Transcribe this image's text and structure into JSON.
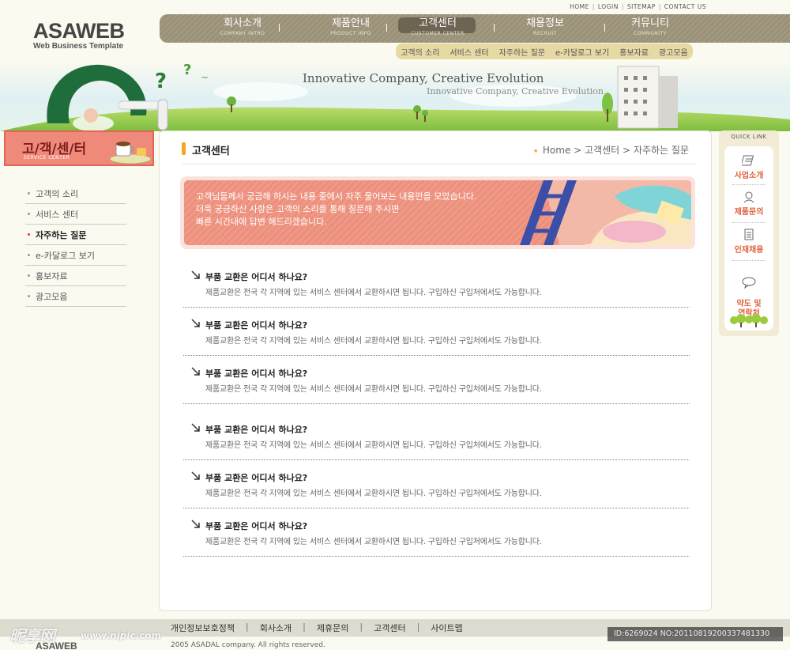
{
  "util": [
    "HOME",
    "LOGIN",
    "SITEMAP",
    "CONTACT US"
  ],
  "logo": {
    "title": "ASAWEB",
    "subtitle": "Web Business Template"
  },
  "gnb": [
    {
      "ko": "회사소개",
      "en": "COMPANY INTRO"
    },
    {
      "ko": "제품안내",
      "en": "PRODUCT INFO"
    },
    {
      "ko": "고객센터",
      "en": "CUSTOMER CENTER",
      "active": true
    },
    {
      "ko": "채용정보",
      "en": "RECRUIT"
    },
    {
      "ko": "커뮤니티",
      "en": "COMMUNITY"
    }
  ],
  "subnav": [
    "고객의 소리",
    "서비스 센터",
    "자주하는 질문",
    "e-카달로그 보기",
    "홍보자료",
    "광고모음"
  ],
  "banner": {
    "title": "Innovative Company, Creative Evolution",
    "subtitle": "Innovative Company, Creative Evolution"
  },
  "left": {
    "title": "고/객/센/터",
    "title_en": "SERVICE CENTER",
    "menu": [
      "고객의 소리",
      "서비스 센터",
      "자주하는 질문",
      "e-카달로그 보기",
      "홍보자료",
      "광고모음"
    ],
    "active_index": 2
  },
  "page": {
    "title": "고객센터",
    "breadcrumb": {
      "home": "Home",
      "sep": ">",
      "section": "고객센터",
      "current": "자주하는 질문"
    },
    "intro": [
      "고객님들께서 궁금해 하시는 내용 중에서 자주 물어보는 내용만을 모았습니다.",
      "더욱 궁금하신 사항은 고객의 소리를 통해 질문해 주시면",
      "빠른 시간내에 답변 해드리겠습니다."
    ],
    "faqs": [
      {
        "q": "부품 교환은 어디서 하나요?",
        "a": "제품교환은 전국 각 지역에 있는 서비스 센터에서 교환하시면 됩니다. 구입하신 구입처에서도 가능합니다."
      },
      {
        "q": "부품 교환은 어디서 하나요?",
        "a": "제품교환은 전국 각 지역에 있는 서비스 센터에서 교환하시면 됩니다. 구입하신 구입처에서도 가능합니다."
      },
      {
        "q": "부품 교환은 어디서 하나요?",
        "a": "제품교환은 전국 각 지역에 있는 서비스 센터에서 교환하시면 됩니다. 구입하신 구입처에서도 가능합니다."
      },
      {
        "q": "부품 교환은 어디서 하나요?",
        "a": "제품교환은 전국 각 지역에 있는 서비스 센터에서 교환하시면 됩니다. 구입하신 구입처에서도 가능합니다."
      },
      {
        "q": "부품 교환은 어디서 하나요?",
        "a": "제품교환은 전국 각 지역에 있는 서비스 센터에서 교환하시면 됩니다. 구입하신 구입처에서도 가능합니다."
      },
      {
        "q": "부품 교환은 어디서 하나요?",
        "a": "제품교환은 전국 각 지역에 있는 서비스 센터에서 교환하시면 됩니다. 구입하신 구입처에서도 가능합니다."
      }
    ]
  },
  "quick": {
    "title": "QUICK LINK",
    "items": [
      {
        "label": "사업소개",
        "icon": "document-icon"
      },
      {
        "label": "제품문의",
        "icon": "person-icon"
      },
      {
        "label": "인재채용",
        "icon": "list-icon"
      },
      {
        "label": "약도 및\n연락처",
        "icon": "chat-icon"
      }
    ]
  },
  "footer": {
    "menu": [
      "개인정보보호정책",
      "회사소개",
      "제휴문의",
      "고객센터",
      "사이트맵"
    ],
    "logo": "ASAWEB",
    "copyright": "2005 ASADAL company. All rights reserved."
  },
  "watermark": {
    "site": "昵享网",
    "url": "www.nipic.com",
    "id": "ID:6269024 NO:20110819200337481330"
  },
  "colors": {
    "gnb": "#9a9178",
    "active_tab": "#6d6453",
    "accent": "#f5a623",
    "left_title": "#ef8a7b",
    "quick_label": "#e0613c"
  }
}
